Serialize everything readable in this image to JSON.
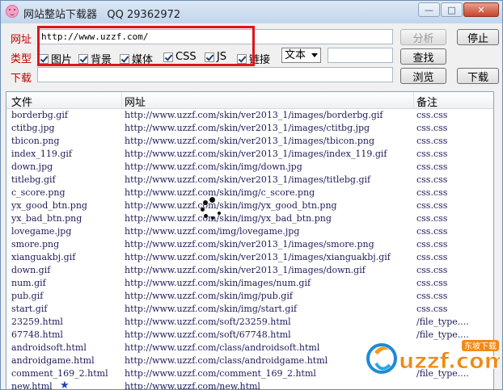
{
  "window": {
    "title": "网站整站下载器",
    "qq": "QQ 29362972",
    "buttons": [
      "minimize",
      "maximize",
      "close"
    ]
  },
  "form": {
    "url_label": "网址",
    "url_value": "http://www.uzzf.com/",
    "type_label": "类型",
    "download_label": "下载",
    "checkboxes": [
      {
        "label": "图片",
        "checked": true
      },
      {
        "label": "背景",
        "checked": true
      },
      {
        "label": "媒体",
        "checked": true
      },
      {
        "label": "CSS",
        "checked": true
      },
      {
        "label": "JS",
        "checked": true
      },
      {
        "label": "链接",
        "checked": true
      }
    ],
    "format_select": "文本",
    "analyze_button": "分析",
    "stop_button": "停止",
    "find_button": "查找",
    "browse_button": "浏览",
    "download_button": "下载"
  },
  "table": {
    "columns": [
      "文件",
      "网址",
      "备注"
    ],
    "rows": [
      {
        "file": "borderbg.gif",
        "url": "http://www.uzzf.com/skin/ver2013_1/images/borderbg.gif",
        "note": "css.css"
      },
      {
        "file": "ctitbg.jpg",
        "url": "http://www.uzzf.com/skin/ver2013_1/images/ctitbg.jpg",
        "note": "css.css"
      },
      {
        "file": "tbicon.png",
        "url": "http://www.uzzf.com/skin/ver2013_1/images/tbicon.png",
        "note": "css.css"
      },
      {
        "file": "index_119.gif",
        "url": "http://www.uzzf.com/skin/ver2013_1/images/index_119.gif",
        "note": "css.css"
      },
      {
        "file": "down.jpg",
        "url": "http://www.uzzf.com/skin/img/down.jpg",
        "note": "css.css"
      },
      {
        "file": "titlebg.gif",
        "url": "http://www.uzzf.com/skin/ver2013_1/images/titlebg.gif",
        "note": "css.css"
      },
      {
        "file": "c_score.png",
        "url": "http://www.uzzf.com/skin/img/c_score.png",
        "note": "css.css"
      },
      {
        "file": "yx_good_btn.png",
        "url": "http://www.uzzf.com/skin/img/yx_good_btn.png",
        "note": "css.css"
      },
      {
        "file": "yx_bad_btn.png",
        "url": "http://www.uzzf.com/skin/img/yx_bad_btn.png",
        "note": "css.css"
      },
      {
        "file": "lovegame.jpg",
        "url": "http://www.uzzf.com/img/lovegame.jpg",
        "note": "css.css"
      },
      {
        "file": "smore.png",
        "url": "http://www.uzzf.com/skin/ver2013_1/images/smore.png",
        "note": "css.css"
      },
      {
        "file": "xianguakbj.gif",
        "url": "http://www.uzzf.com/skin/ver2013_1/images/xianguakbj.gif",
        "note": "css.css"
      },
      {
        "file": "down.gif",
        "url": "http://www.uzzf.com/skin/ver2013_1/images/down.gif",
        "note": "css.css"
      },
      {
        "file": "num.gif",
        "url": "http://www.uzzf.com/skin/images/num.gif",
        "note": "css.css"
      },
      {
        "file": "pub.gif",
        "url": "http://www.uzzf.com/skin/img/pub.gif",
        "note": "css.css"
      },
      {
        "file": "start.gif",
        "url": "http://www.uzzf.com/skin/img/start.gif",
        "note": "css.css"
      },
      {
        "file": "23259.html",
        "url": "http://www.uzzf.com/soft/23259.html",
        "note": "/file_type...."
      },
      {
        "file": "67748.html",
        "url": "http://www.uzzf.com/soft/67748.html",
        "note": "/file_type...."
      },
      {
        "file": "androidsoft.html",
        "url": "http://www.uzzf.com/class/androidsoft.html",
        "note": ""
      },
      {
        "file": "androidgame.html",
        "url": "http://www.uzzf.com/class/androidgame.html",
        "note": ""
      },
      {
        "file": "comment_169_2.html",
        "url": "http://www.uzzf.com/comment_169_2.html",
        "note": "/file_type...."
      },
      {
        "file": "new.html",
        "url": "http://www.uzzf.com/new.html",
        "note": "",
        "star": true
      }
    ]
  },
  "overlay": {
    "spinner_icon": "loading-spinner",
    "watermark_text": "uzzf.com",
    "watermark_subtext": "东坡下载"
  }
}
